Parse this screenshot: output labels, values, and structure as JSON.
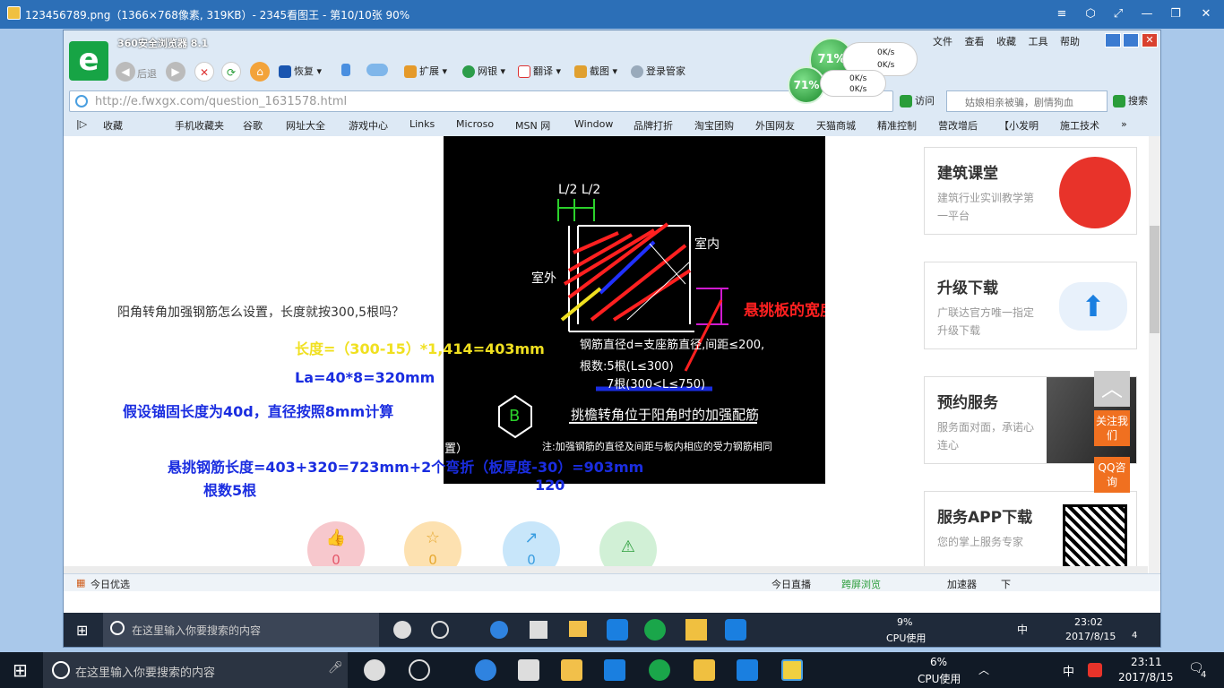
{
  "viewer": {
    "title": "123456789.png（1366×768像素, 319KB）- 2345看图王 - 第10/10张 90%"
  },
  "browser": {
    "name": "360安全浏览器 8.1",
    "menu": [
      "文件",
      "查看",
      "收藏",
      "工具",
      "帮助"
    ],
    "toolbar": {
      "back": "后退",
      "restore": "恢复",
      "extend": "扩展",
      "bank": "网银",
      "translate": "翻译",
      "screenshot": "截图",
      "login": "登录管家"
    },
    "url": "http://e.fwxgx.com/question_1631578.html",
    "go": "访问",
    "search_placeholder": "姑娘相亲被骗，剧情狗血",
    "search_btn": "搜索",
    "favorites": [
      "收藏",
      "手机收藏夹",
      "谷歌",
      "网址大全",
      "游戏中心",
      "Links",
      "Microso",
      "MSN 网",
      "Window",
      "品牌打折",
      "淘宝团购",
      "外国网友",
      "天猫商城",
      "精准控制",
      "营改增后",
      "【小发明",
      "施工技术"
    ],
    "speed": {
      "pct1": "71%",
      "pct2": "71%",
      "up1": "0K/s",
      "down1": "0K/s",
      "up2": "0K/s",
      "down2": "0K/s"
    }
  },
  "content": {
    "question": "阳角转角加强钢筋怎么设置，长度就按300,5根吗？",
    "line1": "长度=（300-15）*1,414=403mm",
    "line2": "La=40*8=320mm",
    "line3": "假设锚固长度为40d，直径按照8mm计算",
    "line4": "悬挑钢筋长度=403+320=723mm+2个弯折（板厚度-30）=903mm",
    "line4b": "120",
    "line5": "根数5根",
    "cad": {
      "dim": "L/2 L/2",
      "indoor": "室内",
      "outdoor": "室外",
      "width_label": "悬挑板的宽度",
      "note1": "钢筋直径d=支座筋直径,间距≤200,",
      "note2": "根数:5根(L≤300)",
      "note3": "7根(300<L≤750)",
      "circle": "B",
      "caption": "挑檐转角位于阳角时的加强配筋",
      "footnote": "注:加强钢筋的直径及间距与板内相应的受力钢筋相同",
      "frag": "置）"
    },
    "actions": [
      {
        "icon": "👍",
        "count": "0"
      },
      {
        "icon": "☆",
        "count": "0"
      },
      {
        "icon": "↗",
        "count": "0"
      },
      {
        "icon": "⚠",
        "count": ""
      }
    ]
  },
  "sidebar": {
    "cards": [
      {
        "title": "建筑课堂",
        "sub": "建筑行业实训教学第一平台"
      },
      {
        "title": "升级下载",
        "sub": "广联达官方唯一指定升级下载"
      },
      {
        "title": "预约服务",
        "sub": "服务面对面，承诺心连心"
      },
      {
        "title": "服务APP下载",
        "sub": "您的掌上服务专家"
      }
    ],
    "follow": "关注我们",
    "qq": "QQ咨询"
  },
  "status": {
    "left": "今日优选",
    "live": "今日直播",
    "cross": "跨屏浏览",
    "accel": "加速器",
    "dl": "下"
  },
  "inner_taskbar": {
    "search": "在这里输入你要搜索的内容",
    "cpu": "9%",
    "cpu_label": "CPU使用",
    "time": "23:02",
    "date": "2017/8/15",
    "ime": "中",
    "notif": "4"
  },
  "taskbar": {
    "search": "在这里输入你要搜索的内容",
    "cpu": "6%",
    "cpu_label": "CPU使用",
    "time": "23:11",
    "date": "2017/8/15",
    "ime": "中",
    "notif": "4"
  }
}
